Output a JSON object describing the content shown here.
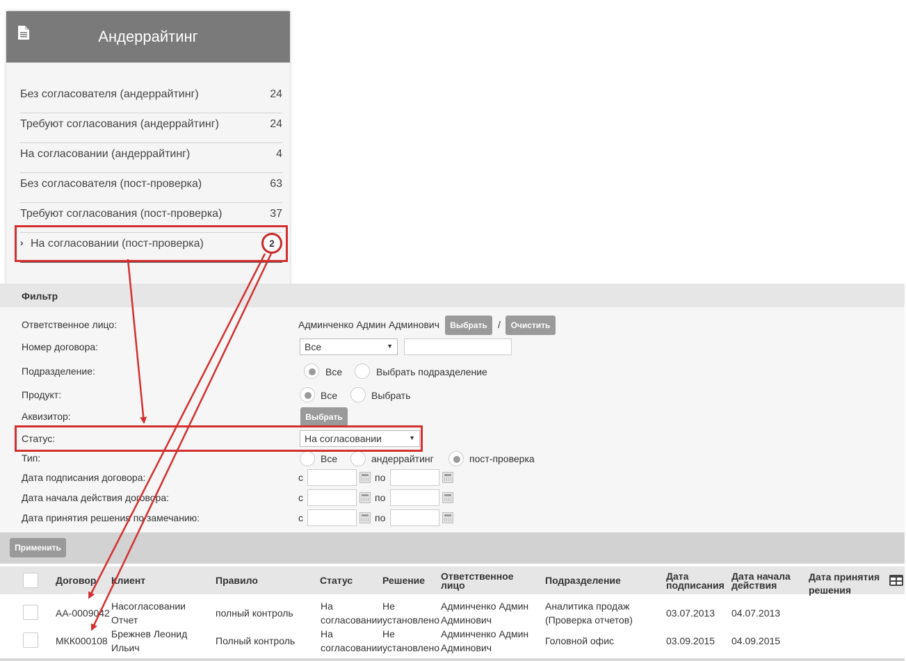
{
  "widget": {
    "title": "Андеррайтинг",
    "items": [
      {
        "label": "Без согласователя (андеррайтинг)",
        "count": "24"
      },
      {
        "label": "Требуют согласования (андеррайтинг)",
        "count": "24"
      },
      {
        "label": "На согласовании (андеррайтинг)",
        "count": "4"
      },
      {
        "label": "Без согласователя (пост-проверка)",
        "count": "63"
      },
      {
        "label": "Требуют согласования (пост-проверка)",
        "count": "37"
      },
      {
        "label": "На согласовании (пост-проверка)",
        "count": "2"
      }
    ]
  },
  "filter": {
    "title": "Фильтр",
    "responsible": {
      "label": "Ответственное лицо:",
      "value": "Админченко Админ Админович",
      "select_btn": "Выбрать",
      "separator": "/",
      "clear_btn": "Очистить"
    },
    "contract_no": {
      "label": "Номер договора:",
      "select_value": "Все",
      "input_value": ""
    },
    "division": {
      "label": "Подразделение:",
      "opt_all": "Все",
      "opt_select": "Выбрать подразделение"
    },
    "product": {
      "label": "Продукт:",
      "opt_all": "Все",
      "opt_select": "Выбрать"
    },
    "acquirer": {
      "label": "Аквизитор:",
      "select_btn": "Выбрать"
    },
    "status": {
      "label": "Статус:",
      "value": "На согласовании"
    },
    "type": {
      "label": "Тип:",
      "opt_all": "Все",
      "opt_under": "андеррайтинг",
      "opt_post": "пост-проверка"
    },
    "sign_date": {
      "label": "Дата подписания договора:",
      "from": "с",
      "to": "по"
    },
    "start_date": {
      "label": "Дата начала действия договора:",
      "from": "с",
      "to": "по"
    },
    "decision_date": {
      "label": "Дата принятия решения по замечанию:",
      "from": "с",
      "to": "по"
    },
    "apply_btn": "Применить"
  },
  "table": {
    "headers": {
      "contract": "Договор",
      "client": "Клиент",
      "rule": "Правило",
      "status": "Статус",
      "decision": "Решение",
      "responsible": "Ответственное лицо",
      "division": "Подразделение",
      "sign_date": "Дата подписания",
      "start_date": "Дата начала действия",
      "decision_date": "Дата принятия решения"
    },
    "rows": [
      {
        "contract": "АА-0009042",
        "client": "Насогласовании Отчет",
        "rule": "полный контроль",
        "status": "На согласовании",
        "decision": "Не установлено",
        "responsible": "Админченко Админ Админович",
        "division": "Аналитика продаж (Проверка отчетов)",
        "sign_date": "03.07.2013",
        "start_date": "04.07.2013",
        "decision_date": ""
      },
      {
        "contract": "МКК000108",
        "client": "Брежнев Леонид Ильич",
        "rule": "Полный контроль",
        "status": "На согласовании",
        "decision": "Не установлено",
        "responsible": "Админченко Админ Админович",
        "division": "Головной офис",
        "sign_date": "03.09.2015",
        "start_date": "04.09.2015",
        "decision_date": ""
      }
    ]
  },
  "annotation": {
    "badge": "2"
  },
  "colors": {
    "header": "#7a7a7a",
    "highlight": "#d32f2f",
    "button": "#9a9a9a"
  }
}
